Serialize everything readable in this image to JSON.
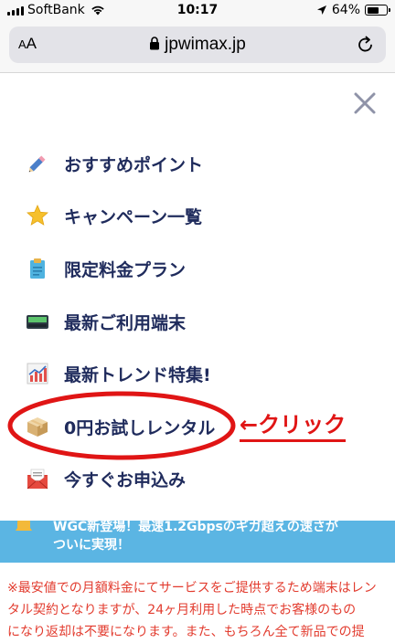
{
  "status_bar": {
    "carrier": "SoftBank",
    "time": "10:17",
    "battery": "64%",
    "battery_level": 0.64
  },
  "browser": {
    "aa_label_small": "A",
    "aa_label_large": "A",
    "url": "jpwimax.jp"
  },
  "menu": {
    "items": [
      {
        "label": "おすすめポイント",
        "icon": "pencil-icon"
      },
      {
        "label": "キャンペーン一覧",
        "icon": "star-icon"
      },
      {
        "label": "限定料金プラン",
        "icon": "clipboard-icon"
      },
      {
        "label": "最新ご利用端末",
        "icon": "device-icon"
      },
      {
        "label": "最新トレンド特集!",
        "icon": "chart-icon"
      },
      {
        "label": "0円お試しレンタル",
        "icon": "box-icon"
      },
      {
        "label": "今すぐお申込み",
        "icon": "envelope-icon"
      }
    ]
  },
  "annotation": {
    "click_label": "←クリック",
    "color": "#e01515"
  },
  "banner": {
    "line1": "WGC新登場！最速1.2Gbpsのギガ超えの速さが",
    "line2": "ついに実現！",
    "color": "#5bb5e3"
  },
  "notice": {
    "lines": [
      "※最安値での月額料金にてサービスをご提供するため端末はレン",
      "タル契約となりますが、24ヶ月利用した時点でお客様のもの",
      "になり返却は不要になります。また、もちろん全て新品での提"
    ],
    "color": "#e23b2e"
  }
}
